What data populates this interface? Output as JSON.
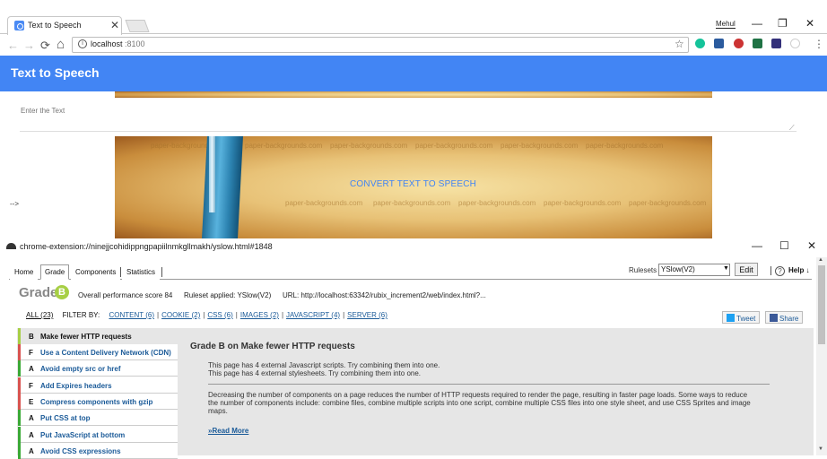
{
  "browser": {
    "tab_title": "Text to Speech",
    "tab_close": "✕",
    "user_name": "Mehul",
    "url_host": "localhost",
    "url_port": ":8100",
    "window_controls": {
      "minimize": "—",
      "restore": "❐",
      "close": "✕"
    },
    "nav": {
      "back": "←",
      "forward": "→",
      "reload": "⟳",
      "home": "⌂"
    },
    "star": "☆",
    "extensions": [
      {
        "name": "grammarly-icon",
        "color": "#15c39a"
      },
      {
        "name": "zotero-icon",
        "color": "#2b5b9e"
      },
      {
        "name": "extension-icon-3",
        "color": "#c33"
      },
      {
        "name": "excel-icon",
        "color": "#1f7244"
      },
      {
        "name": "extension-icon-5",
        "color": "#33307a"
      },
      {
        "name": "extension-icon-6",
        "color": "#cfcfcf"
      }
    ],
    "menu": "⋮"
  },
  "app": {
    "title": "Text to Speech",
    "textarea_placeholder": "Enter the Text",
    "convert_label": "CONVERT TEXT TO SPEECH",
    "arrow_text": "-->",
    "watermark": "paper-backgrounds.com"
  },
  "popup": {
    "url": "chrome-extension://ninejjcohidippngpapiilnmkgllmakh/yslow.html#1848",
    "controls": {
      "minimize": "—",
      "restore": "☐",
      "close": "✕"
    }
  },
  "yslow": {
    "tabs": [
      {
        "label": "Home",
        "active": false
      },
      {
        "label": "Grade",
        "active": true
      },
      {
        "label": "Components",
        "active": false
      },
      {
        "label": "Statistics",
        "active": false
      }
    ],
    "rulesets_label": "Rulesets",
    "rulesets_value": "YSlow(V2)",
    "edit_label": "Edit",
    "help_label": "Help ↓",
    "grade_word": "Grade",
    "grade_letter": "B",
    "grade_color": "#a7cf45",
    "performance": "Overall performance score 84",
    "ruleset_applied": "Ruleset applied: YSlow(V2)",
    "page_url": "URL: http://localhost:63342/rubix_increment2/web/index.html?...",
    "filter": {
      "all": "ALL (23)",
      "label": "FILTER BY:",
      "items": [
        "CONTENT (6)",
        "COOKIE (2)",
        "CSS (6)",
        "IMAGES (2)",
        "JAVASCRIPT (4)",
        "SERVER (6)"
      ]
    },
    "tweet_label": "Tweet",
    "share_label": "Share",
    "rules": [
      {
        "grade": "B",
        "name": "Make fewer HTTP requests",
        "color": "#a7cf45"
      },
      {
        "grade": "F",
        "name": "Use a Content Delivery Network (CDN)",
        "color": "#d9534f"
      },
      {
        "grade": "A",
        "name": "Avoid empty src or href",
        "color": "#3aa935"
      },
      {
        "grade": "F",
        "name": "Add Expires headers",
        "color": "#d9534f"
      },
      {
        "grade": "E",
        "name": "Compress components with gzip",
        "color": "#d9534f"
      },
      {
        "grade": "A",
        "name": "Put CSS at top",
        "color": "#3aa935"
      },
      {
        "grade": "A",
        "name": "Put JavaScript at bottom",
        "color": "#3aa935"
      },
      {
        "grade": "A",
        "name": "Avoid CSS expressions",
        "color": "#3aa935"
      }
    ],
    "detail": {
      "title": "Grade B on Make fewer HTTP requests",
      "line1": "This page has 4 external Javascript scripts. Try combining them into one.",
      "line2": "This page has 4 external stylesheets. Try combining them into one.",
      "description": "Decreasing the number of components on a page reduces the number of HTTP requests required to render the page, resulting in faster page loads. Some ways to reduce the number of components include: combine files, combine multiple scripts into one script, combine multiple CSS files into one style sheet, and use CSS Sprites and image maps.",
      "read_more": "»Read More"
    }
  }
}
